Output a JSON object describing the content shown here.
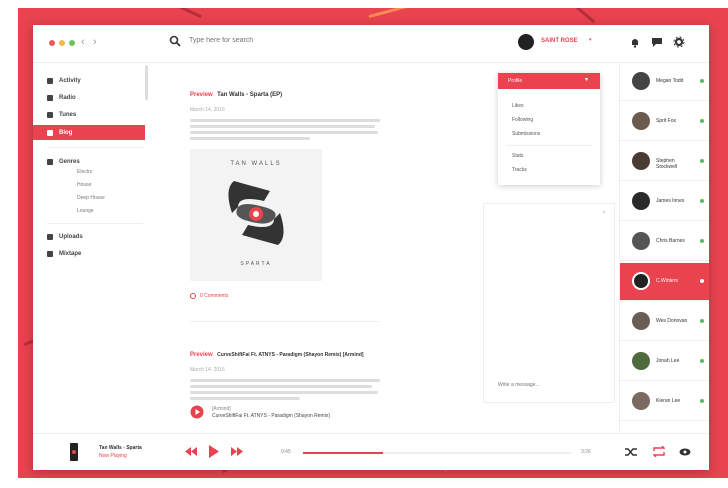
{
  "search": {
    "placeholder": "Type here for search"
  },
  "user": {
    "name": "SAINT ROSE"
  },
  "sidebar": {
    "items": [
      {
        "label": "Activity"
      },
      {
        "label": "Radio"
      },
      {
        "label": "Tunes"
      },
      {
        "label": "Blog"
      }
    ],
    "genres": {
      "label": "Genres",
      "items": [
        "Electro",
        "House",
        "Deep House",
        "Lounge"
      ]
    },
    "bottom": [
      {
        "label": "Uploads"
      },
      {
        "label": "Mixtape"
      }
    ]
  },
  "posts": [
    {
      "tag": "Preview",
      "title": "Tan Walls - Sparta (EP)",
      "date": "March 14, 2016",
      "comments": "0 Comments",
      "album_text": "TAN WALLS",
      "album_sub": "SPARTA"
    },
    {
      "tag": "Preview",
      "title": "CurveShiftFai Ft. ATNYS - Paradigm (Shayon Remix) [Armind]",
      "date": "March 14, 2016",
      "track_label": "[Armind]",
      "track_title": "CurveShiftFai Ft. ATNYS - Paradigm (Shayon Remix)"
    }
  ],
  "dropdown": {
    "header": "Profile",
    "items": [
      "Likes",
      "Following",
      "Submissions"
    ],
    "items2": [
      "Stats",
      "Tracks"
    ]
  },
  "chat": {
    "placeholder": "Write a message..."
  },
  "friends": [
    {
      "name": "Megan Todd",
      "online": true
    },
    {
      "name": "Sprit Fox",
      "online": true
    },
    {
      "name": "Stephen Stockwell",
      "online": true
    },
    {
      "name": "James Innes",
      "online": true
    },
    {
      "name": "Chris Barnes",
      "online": true
    },
    {
      "name": "C.Winters",
      "online": true,
      "active": true
    },
    {
      "name": "Wes Donovan",
      "online": true
    },
    {
      "name": "Jonah Lee",
      "online": true
    },
    {
      "name": "Kieran Lee",
      "online": true
    }
  ],
  "player": {
    "track": "Tan Walls - Sparta",
    "status": "Now Playing",
    "time_current": "0:45",
    "time_total": "3:26",
    "progress": 0.3
  },
  "colors": {
    "accent": "#e8434f",
    "online": "#5dbb63"
  }
}
